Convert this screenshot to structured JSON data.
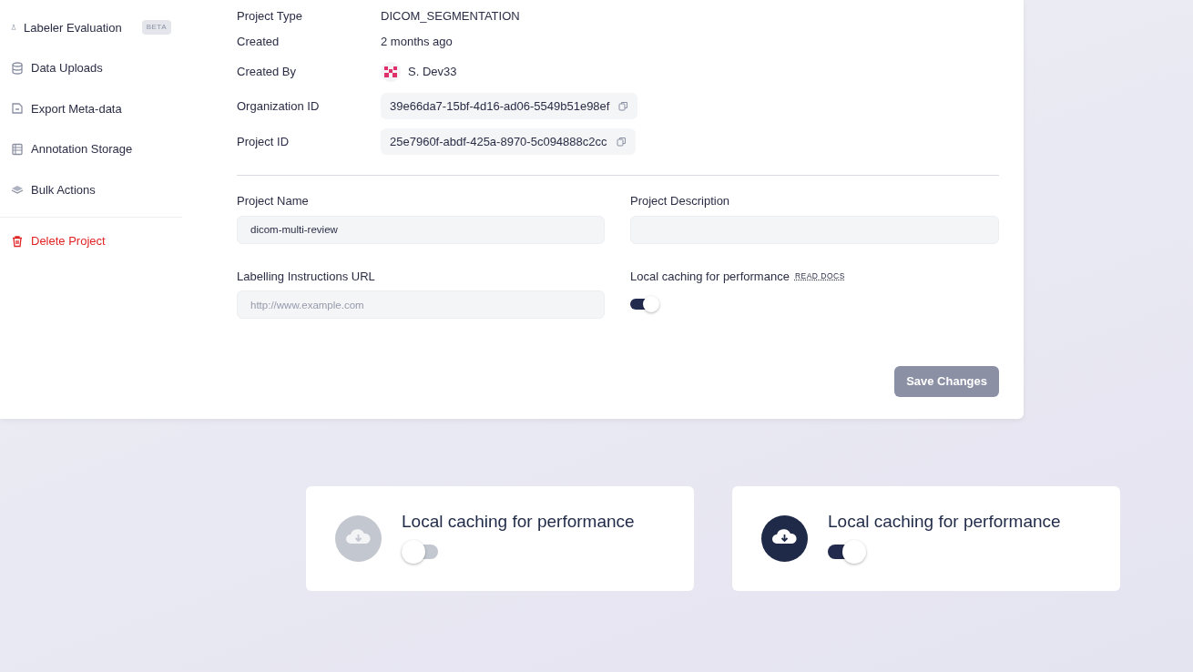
{
  "sidebar": {
    "items": [
      {
        "kind": "flask",
        "label": "Labeler Evaluation",
        "badge": "BETA",
        "danger": false
      },
      {
        "kind": "database",
        "label": "Data Uploads",
        "danger": false
      },
      {
        "kind": "file",
        "label": "Export Meta-data",
        "danger": false
      },
      {
        "kind": "table",
        "label": "Annotation Storage",
        "danger": false
      },
      {
        "kind": "layers",
        "label": "Bulk Actions",
        "danger": false
      },
      {
        "kind": "trash",
        "label": "Delete Project",
        "danger": true
      }
    ]
  },
  "details": [
    {
      "kind": "text",
      "label": "Project Type",
      "value": "DICOM_SEGMENTATION"
    },
    {
      "kind": "text",
      "label": "Created",
      "value": "2 months ago"
    },
    {
      "kind": "user",
      "label": "Created By",
      "value": "S. Dev33"
    },
    {
      "kind": "copy",
      "label": "Organization ID",
      "value": "39e66da7-15bf-4d16-ad06-5549b51e98ef"
    },
    {
      "kind": "copy",
      "label": "Project ID",
      "value": "25e7960f-abdf-425a-8970-5c094888c2cc"
    }
  ],
  "form": {
    "project_name": {
      "label": "Project Name",
      "value": "dicom-multi-review"
    },
    "project_description": {
      "label": "Project Description"
    },
    "instructions_url": {
      "label": "Labelling Instructions URL",
      "placeholder": "http://www.example.com"
    },
    "local_caching": {
      "label": "Local caching for performance",
      "link": "READ DOCS",
      "on": true
    },
    "save_button": {
      "label": "Save Changes",
      "disabled": true
    }
  },
  "feature_cards": [
    {
      "title": "Local caching for performance",
      "on": false
    },
    {
      "title": "Local caching for performance",
      "on": true
    }
  ]
}
